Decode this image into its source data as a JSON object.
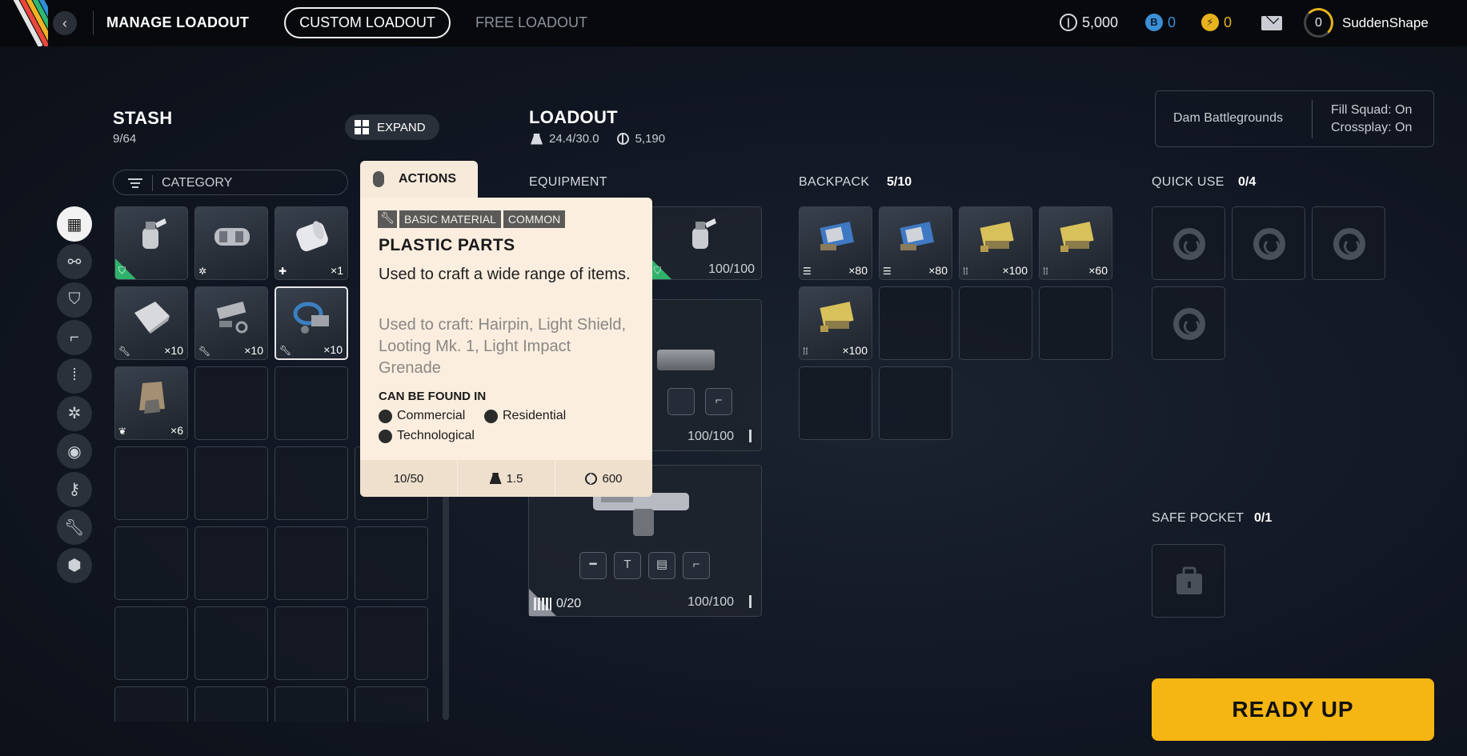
{
  "topbar": {
    "title": "MANAGE LOADOUT",
    "tabs": [
      {
        "label": "CUSTOM LOADOUT",
        "active": true
      },
      {
        "label": "FREE LOADOUT",
        "active": false
      }
    ],
    "currencies": [
      {
        "icon": "coins-icon",
        "value": "5,000",
        "color": "#d8dbe0"
      },
      {
        "icon": "blue-token-icon",
        "value": "0",
        "color": "#3b8fd6"
      },
      {
        "icon": "gold-token-icon",
        "value": "0",
        "color": "#e7b21f"
      }
    ],
    "level": "0",
    "username": "SuddenShape",
    "accent": "#e7b21f"
  },
  "stash": {
    "title": "STASH",
    "count": "9/64",
    "expand_label": "EXPAND",
    "category_label": "CATEGORY",
    "rail_icons": [
      "all-items-icon",
      "augment-icon",
      "shield-icon",
      "weapon-icon",
      "ammo-icon",
      "mods-icon",
      "quick-use-icon",
      "keys-icon",
      "crafting-icon",
      "misc-icon"
    ],
    "items": [
      {
        "name": "grenade-item",
        "tag": "shield",
        "qty": "",
        "rarity": "uncommon"
      },
      {
        "name": "canister-item",
        "tag": "gear",
        "qty": "",
        "rarity": "common"
      },
      {
        "name": "bandage-item",
        "tag": "plus",
        "qty": "×1",
        "rarity": "common"
      },
      {
        "name": "fabric-item",
        "tag": "wrench",
        "qty": "×10",
        "rarity": "common"
      },
      {
        "name": "metal-parts-item",
        "tag": "wrench",
        "qty": "×10",
        "rarity": "common"
      },
      {
        "name": "plastic-parts-item",
        "tag": "wrench",
        "qty": "×10",
        "rarity": "common",
        "selected": true
      },
      {
        "name": "sack-item",
        "tag": "leaf",
        "qty": "×6",
        "rarity": "common"
      }
    ]
  },
  "tooltip": {
    "actions_label": "ACTIONS",
    "tags": [
      "BASIC MATERIAL",
      "COMMON"
    ],
    "title": "PLASTIC PARTS",
    "description": "Used to craft a wide range of items.",
    "crafting": "Used to craft: Hairpin, Light Shield, Looting Mk. 1, Light Impact Grenade",
    "found_in_label": "CAN BE FOUND IN",
    "locations": [
      "Commercial",
      "Residential",
      "Technological"
    ],
    "stack": "10/50",
    "weight": "1.5",
    "value": "600"
  },
  "loadout": {
    "title": "LOADOUT",
    "weight": "24.4/30.0",
    "value": "5,190",
    "equipment_label": "EQUIPMENT",
    "augment_durability": "100/100",
    "weapon1_durability": "100/100",
    "weapon2_ammo": "0/20",
    "weapon2_durability": "100/100"
  },
  "backpack": {
    "label": "BACKPACK",
    "count": "5/10",
    "items": [
      {
        "name": "light-ammo-item",
        "qty": "×80"
      },
      {
        "name": "light-ammo-item",
        "qty": "×80"
      },
      {
        "name": "heavy-ammo-item",
        "qty": "×100"
      },
      {
        "name": "heavy-ammo-item",
        "qty": "×60"
      },
      {
        "name": "heavy-ammo-item",
        "qty": "×100"
      }
    ]
  },
  "raid": {
    "map": "Dam Battlegrounds",
    "fill_squad": "Fill Squad: On",
    "crossplay": "Crossplay: On"
  },
  "quick_use": {
    "label": "QUICK USE",
    "count": "0/4"
  },
  "safe_pocket": {
    "label": "SAFE POCKET",
    "count": "0/1"
  },
  "ready_label": "READY UP"
}
